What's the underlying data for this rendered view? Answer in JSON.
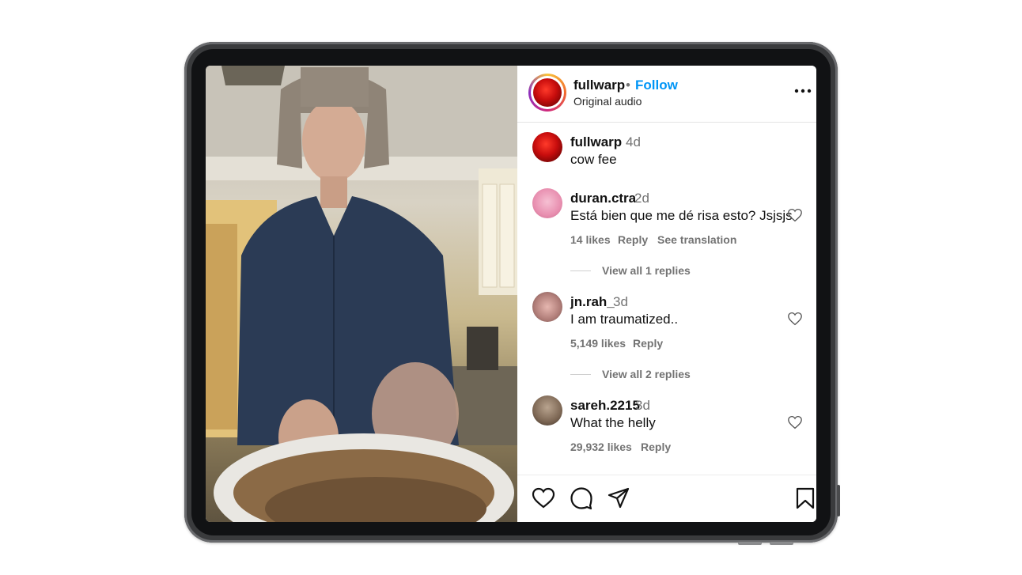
{
  "post": {
    "username": "fullwarp",
    "separator": "•",
    "follow_label": "Follow",
    "audio": "Original audio",
    "more_icon": "more-horizontal-icon"
  },
  "comments": [
    {
      "user": "fullwarp",
      "time": "4d",
      "text": "cow fee",
      "avatar_color": "#c80d0d"
    },
    {
      "user": "duran.ctra",
      "time": "2d",
      "text": "Está bien que me dé risa esto? Jsjsjs",
      "likes": "14 likes",
      "reply": "Reply",
      "translate": "See translation",
      "view_replies": "View all 1 replies",
      "avatar_color": "#f2a6c3"
    },
    {
      "user": "jn.rah_",
      "time": "3d",
      "text": "I am traumatized..",
      "likes": "5,149 likes",
      "reply": "Reply",
      "view_replies": "View all 2 replies",
      "avatar_color": "#b48a86"
    },
    {
      "user": "sareh.2215",
      "time": "3d",
      "text": "What the helly",
      "likes": "29,932 likes",
      "reply": "Reply",
      "avatar_color": "#8c7a6a"
    }
  ],
  "actions": {
    "like_icon": "heart-icon",
    "comment_icon": "comment-icon",
    "share_icon": "send-icon",
    "save_icon": "bookmark-icon"
  },
  "colors": {
    "accent": "#0095f6",
    "muted": "#737373",
    "text": "#111111"
  }
}
